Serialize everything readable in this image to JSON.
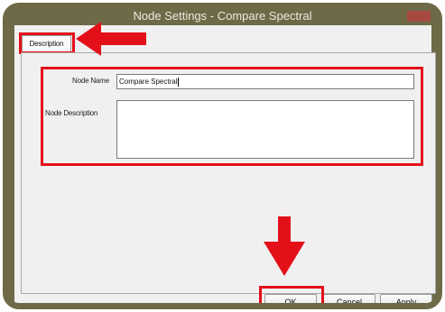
{
  "window": {
    "title": "Node Settings - Compare Spectral"
  },
  "tabs": [
    {
      "label": "Description",
      "selected": true
    }
  ],
  "form": {
    "node_name_label": "Node Name",
    "node_name_value": "Compare Spectral",
    "node_description_label": "Node Description",
    "node_description_value": ""
  },
  "buttons": {
    "ok": "OK",
    "cancel": "Cancel",
    "apply": "Apply"
  },
  "annotation_color": "#e3101a"
}
